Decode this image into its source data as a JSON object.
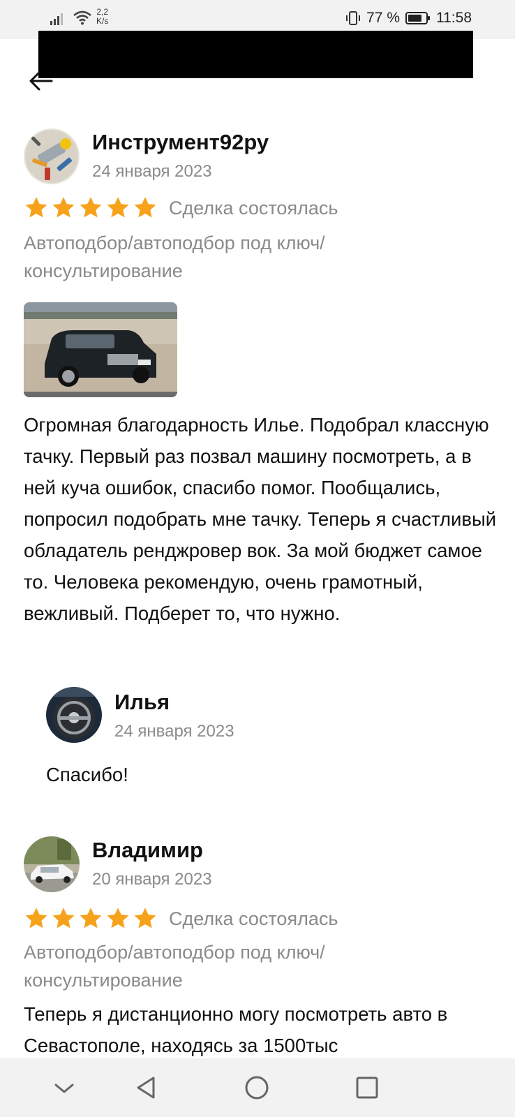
{
  "status_bar": {
    "speed_value": "2,2",
    "speed_unit": "K/s",
    "battery": "77 %",
    "time": "11:58"
  },
  "reviews": [
    {
      "author": "Инструмент92ру",
      "date": "24 января 2023",
      "rating": 5,
      "deal_status": "Сделка состоялась",
      "category": "Автоподбор/автоподбор под ключ/ консультирование",
      "text": "Огромная благодарность Илье. Подобрал классную тачку. Первый раз позвал машину посмотреть, а в ней куча ошибок, спасибо помог. Пообщались, попросил подобрать мне тачку. Теперь я счастливый обладатель ренджровер вок. За мой бюджет самое то. Человека рекомендую, очень грамотный, вежливый. Подберет то, что нужно.",
      "reply": {
        "author": "Илья",
        "date": "24 января 2023",
        "text": "Спасибо!"
      }
    },
    {
      "author": "Владимир",
      "date": "20 января 2023",
      "rating": 5,
      "deal_status": "Сделка состоялась",
      "category": "Автоподбор/автоподбор под ключ/ консультирование",
      "text": "Теперь я дистанционно могу посмотреть авто в Севастополе, находясь за 1500тыс"
    }
  ],
  "colors": {
    "star": "#f7a21b",
    "muted_text": "#8a8a8a",
    "redaction": "#000000"
  }
}
